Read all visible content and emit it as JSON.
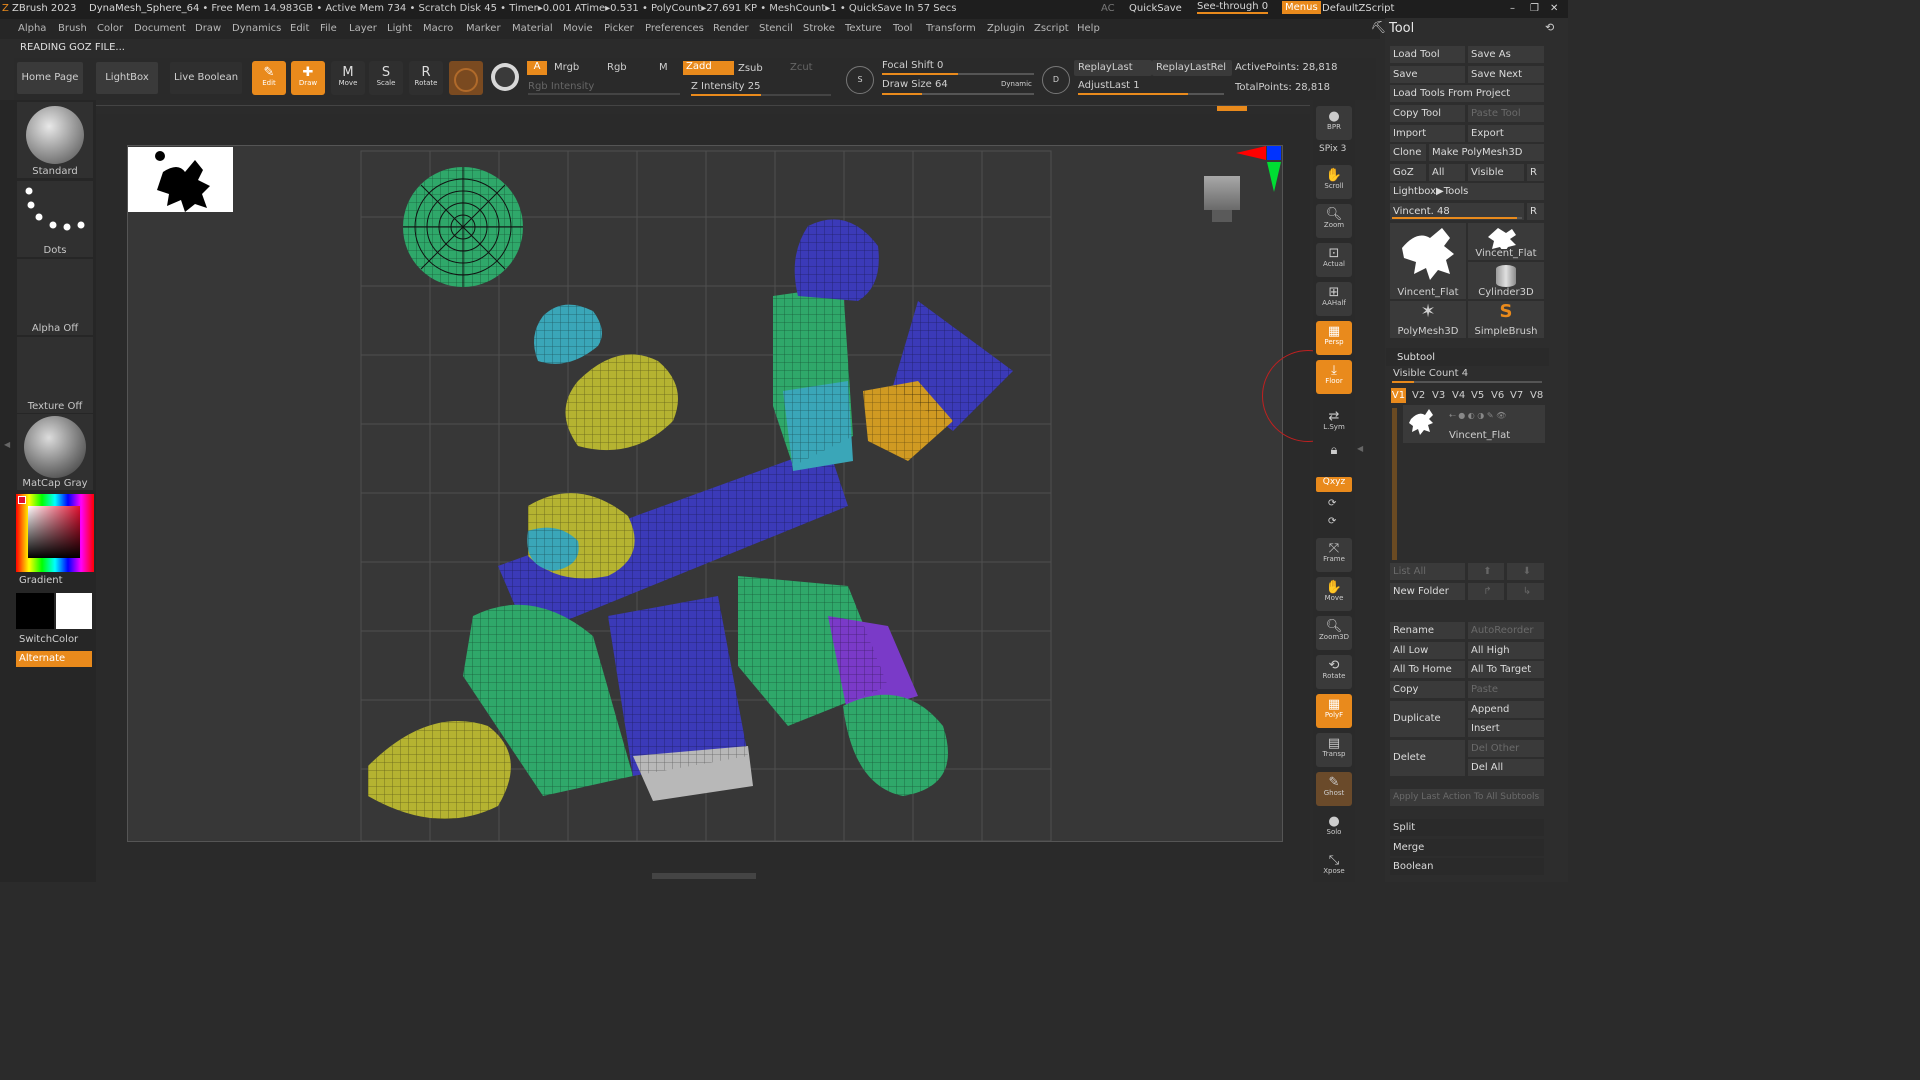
{
  "titlebar": {
    "app": "ZBrush 2023",
    "doc": "DynaMesh_Sphere_64",
    "stats": ". • Free Mem 14.983GB • Active Mem 734 • Scratch Disk 45 • Timer▸0.001 ATime▸0.531 • PolyCount▸27.691 KP • MeshCount▸1 • QuickSave In 57 Secs",
    "ac": "AC",
    "quicksave": "QuickSave",
    "seethrough": "See-through  0",
    "menus": "Menus",
    "script": "DefaultZScript"
  },
  "menubar": [
    "Alpha",
    "Brush",
    "Color",
    "Document",
    "Draw",
    "Dynamics",
    "Edit",
    "File",
    "Layer",
    "Light",
    "Macro",
    "Marker",
    "Material",
    "Movie",
    "Picker",
    "Preferences",
    "Render",
    "Stencil",
    "Stroke",
    "Texture",
    "Tool",
    "Transform",
    "Zplugin",
    "Zscript",
    "Help"
  ],
  "status": "READING GOZ FILE...",
  "shelf": {
    "home": "Home Page",
    "lightbox": "LightBox",
    "liveboolean": "Live Boolean",
    "edit": "Edit",
    "draw": "Draw",
    "move": "Move",
    "scale": "Scale",
    "rotate": "Rotate",
    "a": "A",
    "mrgb": "Mrgb",
    "rgb": "Rgb",
    "m": "M",
    "zadd": "Zadd",
    "zsub": "Zsub",
    "zcut": "Zcut",
    "rgb_intensity": "Rgb Intensity",
    "z_intensity": "Z Intensity 25",
    "focal_shift": "Focal Shift 0",
    "draw_size": "Draw Size 64",
    "dynamic": "Dynamic",
    "replaylast": "ReplayLast",
    "replaylastrel": "ReplayLastRel",
    "adjustlast": "AdjustLast 1",
    "active_points": "ActivePoints: 28,818",
    "total_points": "TotalPoints: 28,818"
  },
  "left": {
    "brush": "Standard",
    "stroke": "Dots",
    "alpha": "Alpha Off",
    "texture": "Texture Off",
    "material": "MatCap Gray",
    "gradient": "Gradient",
    "switchcolor": "SwitchColor",
    "alternate": "Alternate"
  },
  "right": {
    "bpr": "BPR",
    "spix": "SPix 3",
    "scroll": "Scroll",
    "zoom": "Zoom",
    "actual": "Actual",
    "aahalf": "AAHalf",
    "persp": "Persp",
    "floor": "Floor",
    "lsym": "L.Sym",
    "xyz": "Qxyz",
    "frame": "Frame",
    "move": "Move",
    "zoom3d": "Zoom3D",
    "rotate": "Rotate",
    "polyf": "PolyF",
    "transp": "Transp",
    "ghost": "Ghost",
    "solo": "Solo",
    "xpose": "Xpose"
  },
  "tool": {
    "title": "Tool",
    "load_tool": "Load Tool",
    "save_as": "Save As",
    "save": "Save",
    "save_next": "Save Next",
    "load_from_project": "Load Tools From Project",
    "copy_tool": "Copy Tool",
    "paste_tool": "Paste Tool",
    "import": "Import",
    "export": "Export",
    "clone": "Clone",
    "make_polymesh": "Make PolyMesh3D",
    "goz": "GoZ",
    "all": "All",
    "visible": "Visible",
    "r": "R",
    "lightbox_tools": "Lightbox▶Tools",
    "vincent_slider": "Vincent. 48",
    "thumbs": [
      "Vincent_Flat",
      "Vincent_Flat",
      "Cylinder3D",
      "PolyMesh3D",
      "SimpleBrush"
    ],
    "subtool": "Subtool",
    "visible_count": "Visible Count 4",
    "versions": [
      "V1",
      "V2",
      "V3",
      "V4",
      "V5",
      "V6",
      "V7",
      "V8"
    ],
    "subtool_name": "Vincent_Flat",
    "list_all": "List All",
    "new_folder": "New Folder",
    "rename": "Rename",
    "autoreorder": "AutoReorder",
    "all_low": "All Low",
    "all_high": "All High",
    "all_to_home": "All To Home",
    "all_to_target": "All To Target",
    "copy": "Copy",
    "paste": "Paste",
    "duplicate": "Duplicate",
    "append": "Append",
    "insert": "Insert",
    "delete": "Delete",
    "del_other": "Del Other",
    "del_all": "Del All",
    "apply_last": "Apply Last Action To All Subtools",
    "split": "Split",
    "merge": "Merge",
    "boolean": "Boolean"
  },
  "colors": {
    "accent": "#e98a1c",
    "uv_green": "#2fa86a",
    "uv_blue": "#3b3ab8",
    "uv_yellow": "#b5b331",
    "uv_cyan": "#3aa6b8"
  }
}
